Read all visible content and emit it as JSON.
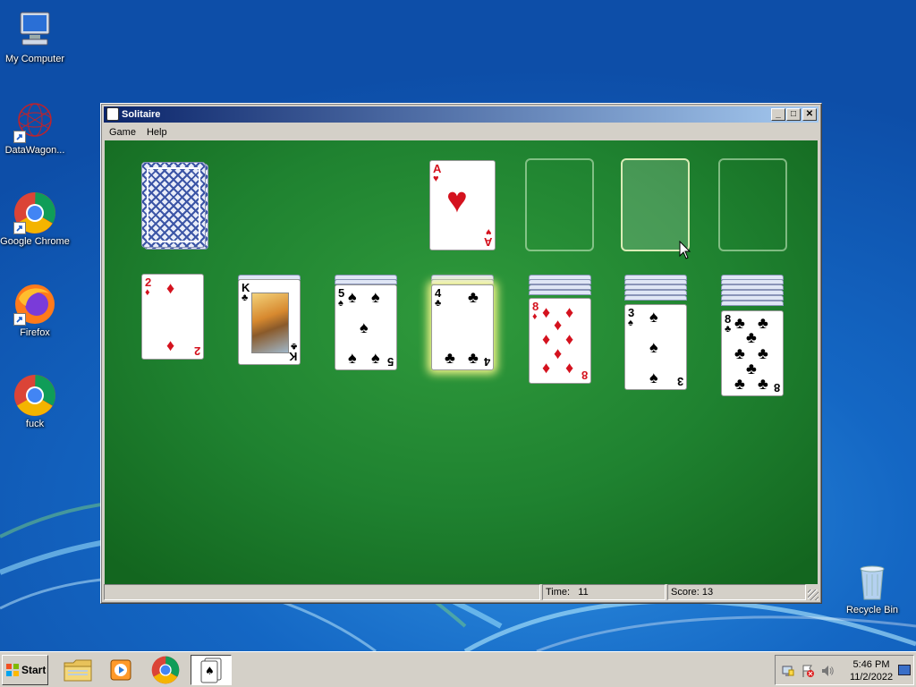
{
  "desktop": {
    "icons": [
      {
        "label": "My Computer",
        "icon": "computer-icon"
      },
      {
        "label": "DataWagon...",
        "icon": "network-sphere-icon"
      },
      {
        "label": "Google Chrome",
        "icon": "chrome-icon"
      },
      {
        "label": "Firefox",
        "icon": "firefox-icon"
      },
      {
        "label": "fuck",
        "icon": "chrome-icon"
      },
      {
        "label": "Recycle Bin",
        "icon": "recycle-bin-icon"
      }
    ]
  },
  "window": {
    "title": "Solitaire",
    "menu": [
      "Game",
      "Help"
    ],
    "status": {
      "time_label": "Time:",
      "time_value": "11",
      "score_label": "Score:",
      "score_value": "13"
    }
  },
  "game": {
    "foundations": [
      {
        "rank": "A",
        "suit": "♥",
        "color": "red"
      },
      {
        "empty": true
      },
      {
        "empty": true,
        "highlighted": true
      },
      {
        "empty": true
      }
    ],
    "tableau": [
      {
        "hidden": 0,
        "top": {
          "rank": "2",
          "suit": "♦",
          "color": "red"
        }
      },
      {
        "hidden": 1,
        "top": {
          "rank": "K",
          "suit": "♣",
          "color": "black",
          "face": true
        }
      },
      {
        "hidden": 2,
        "top": {
          "rank": "5",
          "suit": "♠",
          "color": "black"
        }
      },
      {
        "hidden": 2,
        "top": {
          "rank": "4",
          "suit": "♣",
          "color": "black",
          "selected": true
        }
      },
      {
        "hidden": 4,
        "top": {
          "rank": "8",
          "suit": "♦",
          "color": "red"
        }
      },
      {
        "hidden": 5,
        "top": {
          "rank": "3",
          "suit": "♠",
          "color": "black"
        }
      },
      {
        "hidden": 6,
        "top": {
          "rank": "8",
          "suit": "♣",
          "color": "black"
        }
      }
    ]
  },
  "taskbar": {
    "start_label": "Start",
    "apps": [
      "file-explorer-icon",
      "media-player-icon",
      "chrome-icon",
      "solitaire-icon"
    ],
    "clock_time": "5:46 PM",
    "clock_date": "11/2/2022"
  }
}
